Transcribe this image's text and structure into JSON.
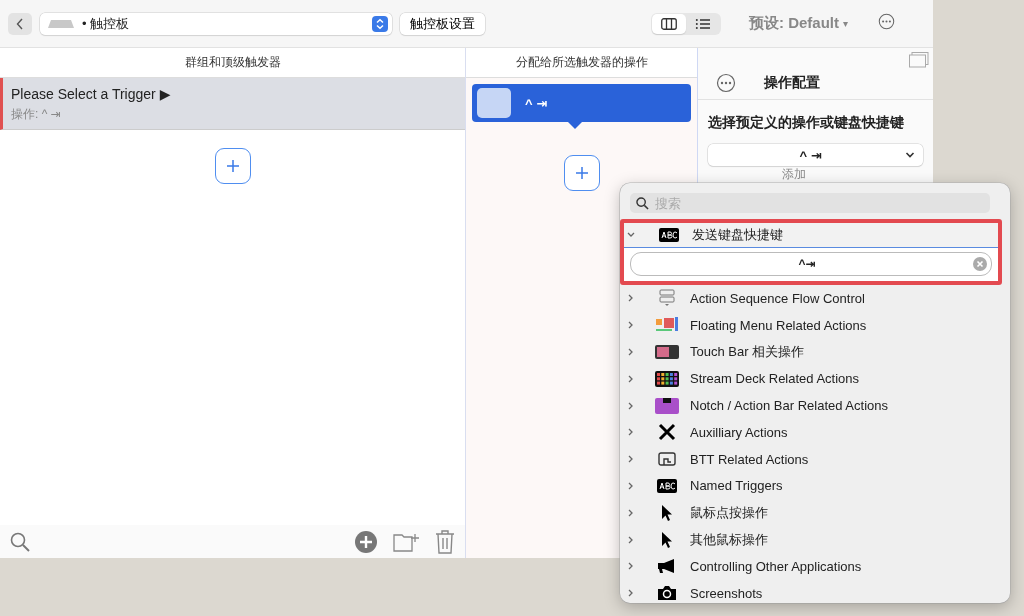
{
  "toolbar": {
    "device": "• 触控板",
    "settings_button": "触控板设置",
    "view_modes": [
      {
        "selected": true
      },
      {
        "selected": false
      }
    ],
    "preset": "预设: Default",
    "preset_caret": "▾"
  },
  "triggers_panel": {
    "header": "群组和顶级触发器",
    "items": [
      {
        "title": "Please Select a Trigger ▶",
        "subtitle": "操作: ^ ⇥",
        "selected": true
      }
    ]
  },
  "actions_panel": {
    "header": "分配给所选触发器的操作",
    "items": [
      {
        "label": "^ ⇥",
        "selected": true
      }
    ]
  },
  "config_panel": {
    "title": "操作配置",
    "prompt": "选择预定义的操作或键盘快捷键",
    "dropdown_value": "^ ⇥",
    "hint": "添加"
  },
  "popup": {
    "search_placeholder": "搜索",
    "categories": [
      {
        "label": "发送键盘快捷键",
        "expanded": true,
        "field_value": "^⇥"
      },
      {
        "label": "Action Sequence Flow Control",
        "expanded": false
      },
      {
        "label": "Floating Menu Related Actions",
        "expanded": false
      },
      {
        "label": "Touch Bar 相关操作",
        "expanded": false
      },
      {
        "label": "Stream Deck Related Actions",
        "expanded": false
      },
      {
        "label": "Notch / Action Bar Related Actions",
        "expanded": false
      },
      {
        "label": "Auxilliary Actions",
        "expanded": false
      },
      {
        "label": "BTT Related Actions",
        "expanded": false
      },
      {
        "label": "Named Triggers",
        "expanded": false
      },
      {
        "label": "鼠标点按操作",
        "expanded": false
      },
      {
        "label": "其他鼠标操作",
        "expanded": false
      },
      {
        "label": "Controlling Other Applications",
        "expanded": false
      },
      {
        "label": "Screenshots",
        "expanded": false
      }
    ]
  }
}
